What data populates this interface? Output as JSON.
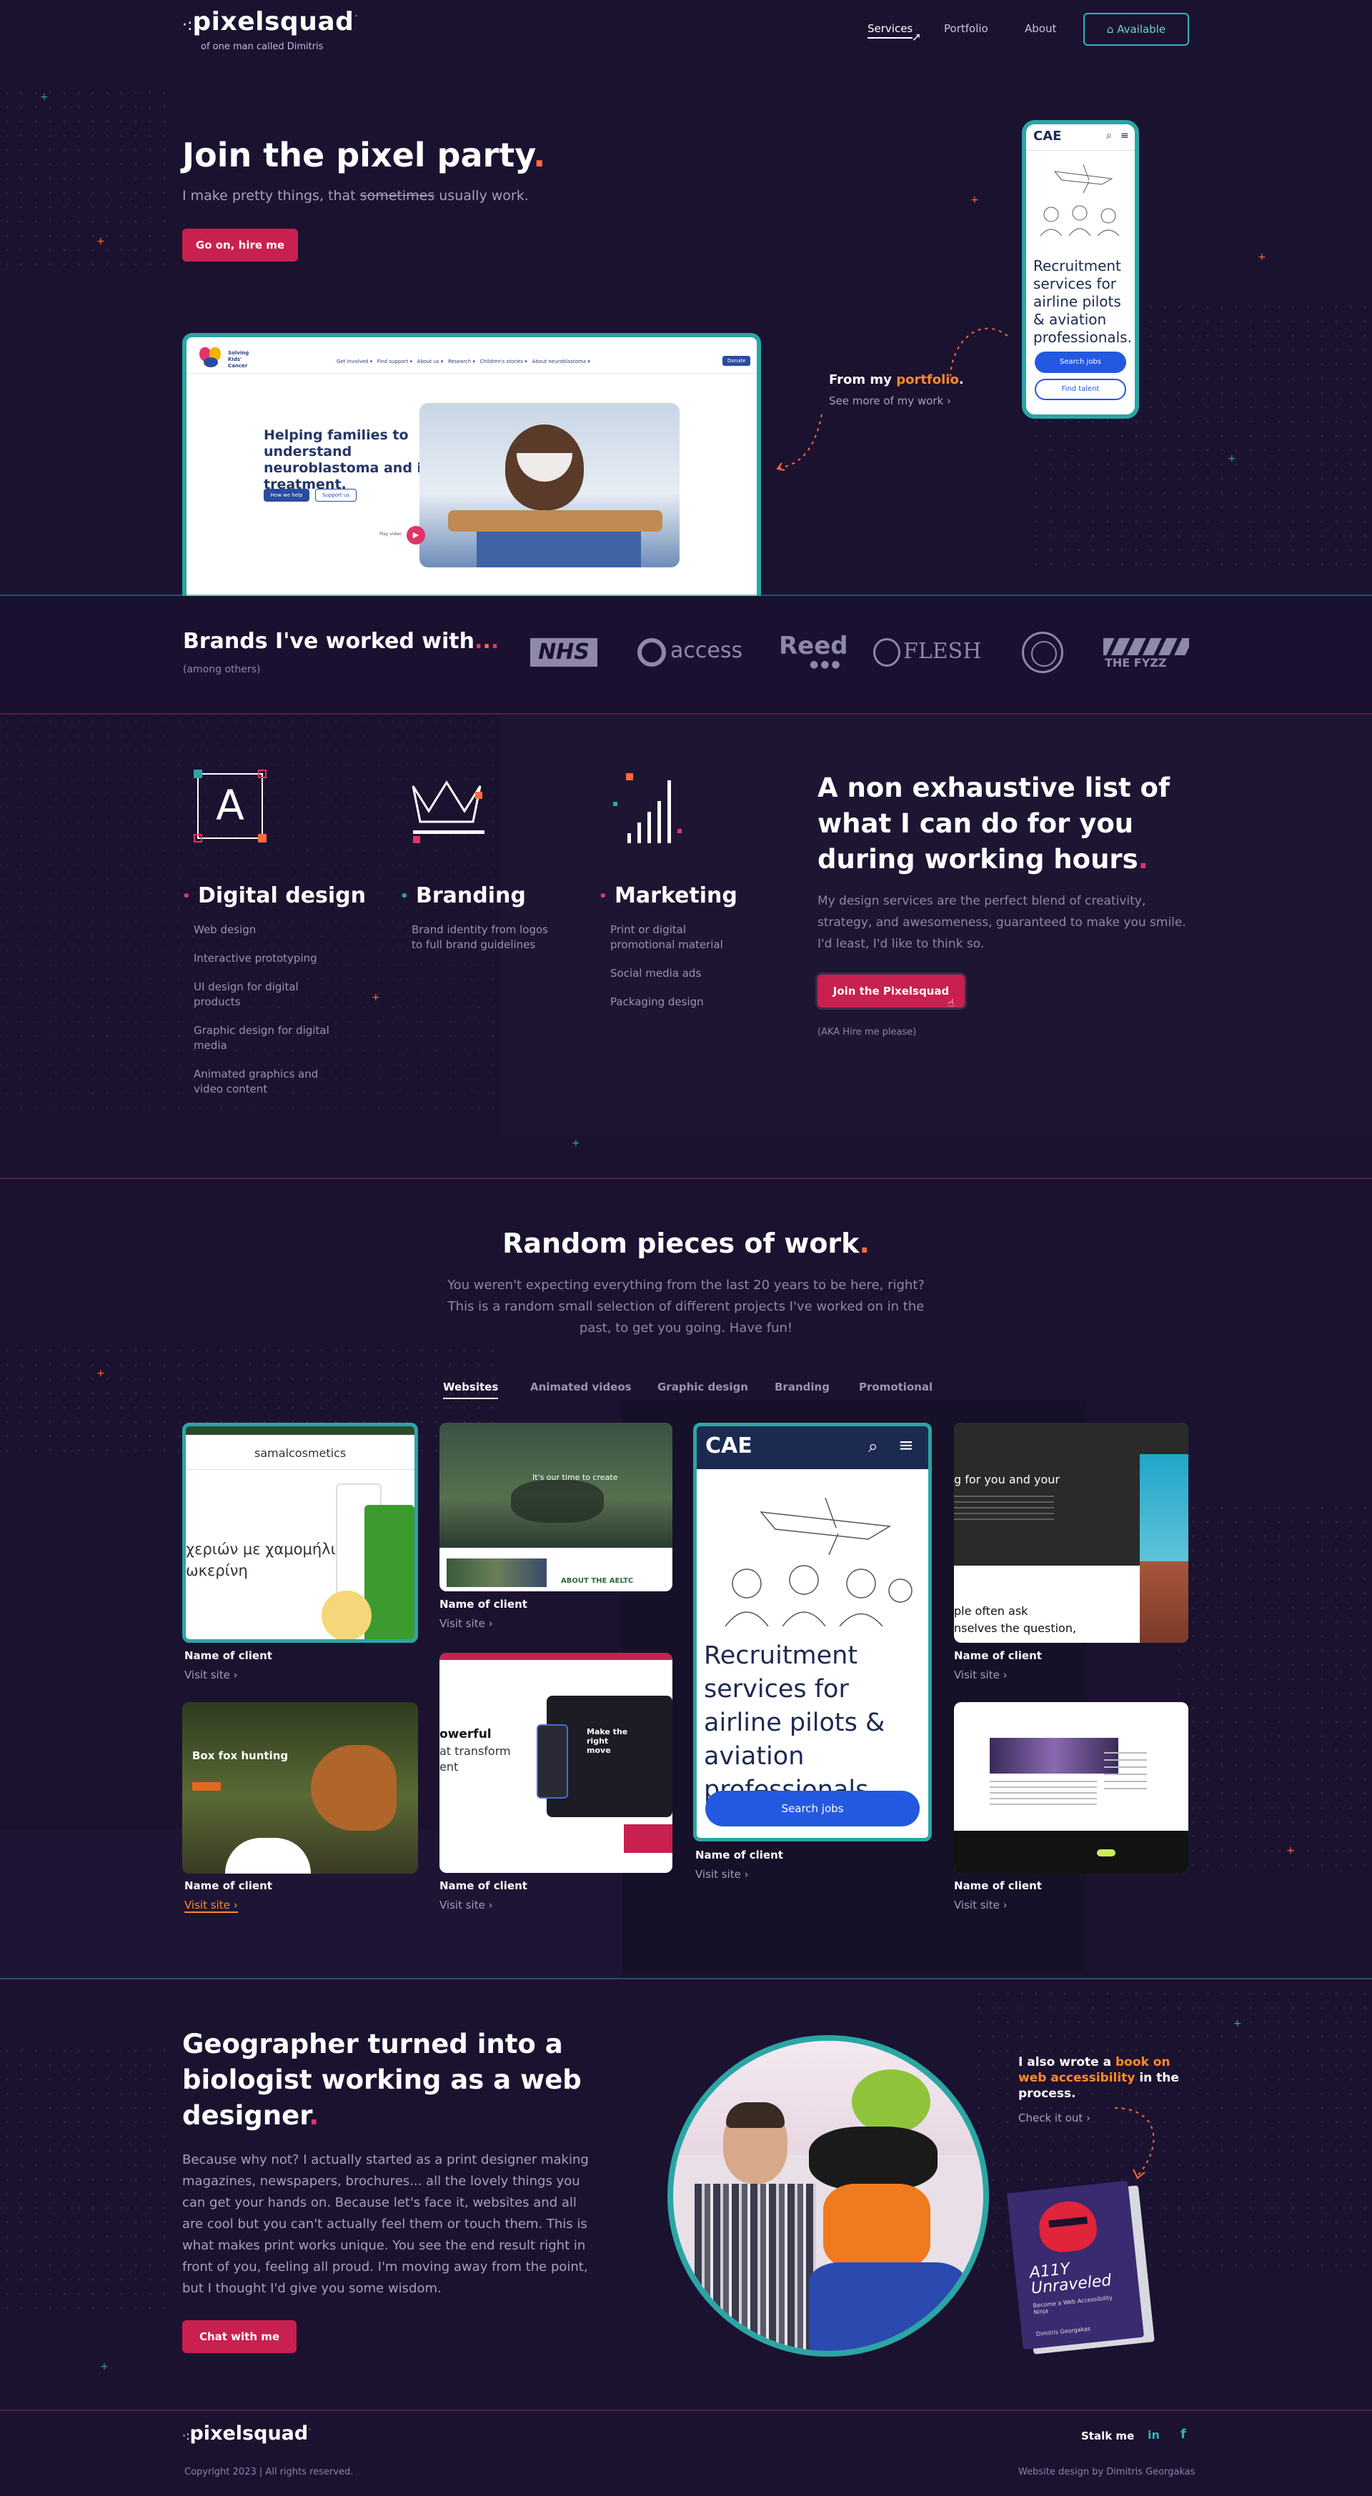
{
  "header": {
    "logo": "pixelsquad",
    "tagline": "of one man called Dimitris",
    "nav": [
      "Services",
      "Portfolio",
      "About"
    ],
    "available": "Available"
  },
  "hero": {
    "title": "Join the pixel party",
    "subtitle_pre": "I make pretty things, that",
    "subtitle_strike": "sometimes",
    "subtitle_post": "usually work.",
    "cta": "Go on, hire me",
    "portfolio_label_pre": "From my",
    "portfolio_label_hl": "portfolio",
    "portfolio_link": "See more of my work",
    "mock_site": {
      "org": "Solving Kids' Cancer",
      "nav": [
        "Get involved",
        "Find support",
        "About us",
        "Research",
        "Children's stories",
        "About neuroblastoma"
      ],
      "donate": "Donate",
      "headline": "Helping families to understand neuroblastoma and its treatment.",
      "btn1": "How we help",
      "btn2": "Support us",
      "video": "Play video"
    },
    "mock_phone": {
      "brand": "CAE",
      "headline": "Recruitment services for airline pilots & aviation professionals.",
      "btn1": "Search jobs",
      "btn2": "Find talent"
    }
  },
  "brands": {
    "title": "Brands I've worked with",
    "note": "(among others)",
    "logos": [
      "NHS",
      "access",
      "Reed",
      "FLESH",
      "seal",
      "THE FYZZ"
    ]
  },
  "services": {
    "items": [
      {
        "title": "Digital design",
        "list": [
          "Web design",
          "Interactive prototyping",
          "UI design for digital products",
          "Graphic design for digital media",
          "Animated graphics and video content"
        ]
      },
      {
        "title": "Branding",
        "list": [
          "Brand identity from logos to full brand guidelines"
        ]
      },
      {
        "title": "Marketing",
        "list": [
          "Print or digital promotional material",
          "Social media ads",
          "Packaging design"
        ]
      }
    ],
    "heading": "A non exhaustive list of what I can do for you during working hours",
    "body": "My design services are the perfect blend of creativity, strategy, and awesomeness, guaranteed to make you smile. I'd least, I'd like to think so.",
    "cta": "Join the Pixelsquad",
    "note": "(AKA Hire me please)"
  },
  "work": {
    "title": "Random pieces of work",
    "intro": "You weren't expecting everything from the last 20 years to be here, right? This is a random small selection of different projects I've worked on in the past, to get you going. Have fun!",
    "tabs": [
      "Websites",
      "Animated videos",
      "Graphic design",
      "Branding",
      "Promotional"
    ],
    "client_label": "Name of client",
    "visit_label": "Visit site",
    "card_texts": {
      "samal": "samalcosmetics",
      "greek": "χεριών με χαμομήλι",
      "it_time": "It's our time to create",
      "about": "ABOUT THE AELTC",
      "cae_brand": "CAE",
      "cae_headline": "Recruitment services for airline pilots & aviation professionals.",
      "cae_btn": "Search jobs",
      "people": "g for you and your",
      "people2": "ple often ask",
      "people3": "nselves the question,",
      "fox": "Box fox hunting",
      "powerful": "owerful",
      "transform": "at transform",
      "ent": "ent",
      "make": "Make the right move"
    }
  },
  "about": {
    "title": "Geographer turned into a biologist working as a web designer",
    "body": "Because why not? I actually started as a print designer making magazines, newspapers, brochures... all the lovely things you can get your hands on. Because let's face it, websites and all are cool but you can't actually feel them or touch them. This is what makes print works unique. You see the end result right in front of you, feeling all proud. I'm moving away from the point, but I thought I'd give you some wisdom.",
    "cta": "Chat with me",
    "book_pre": "I also wrote a",
    "book_hl": "book on web accessibility",
    "book_post": "in the process.",
    "book_link": "Check it out",
    "book_title": "A11Y Unraveled",
    "book_sub": "Become a Web Accessibility Ninja",
    "book_author": "Dimitris Georgakas"
  },
  "footer": {
    "logo": "pixelsquad",
    "copyright": "Copyright 2023 | All rights reserved.",
    "stalk": "Stalk me",
    "social": [
      "in",
      "f"
    ],
    "credit": "Website design by Dimitris Georgakas"
  },
  "colors": {
    "bg": "#1b1230",
    "accent_red": "#c8204f",
    "accent_teal": "#2aa6a4",
    "accent_orange": "#ff6a3d"
  }
}
